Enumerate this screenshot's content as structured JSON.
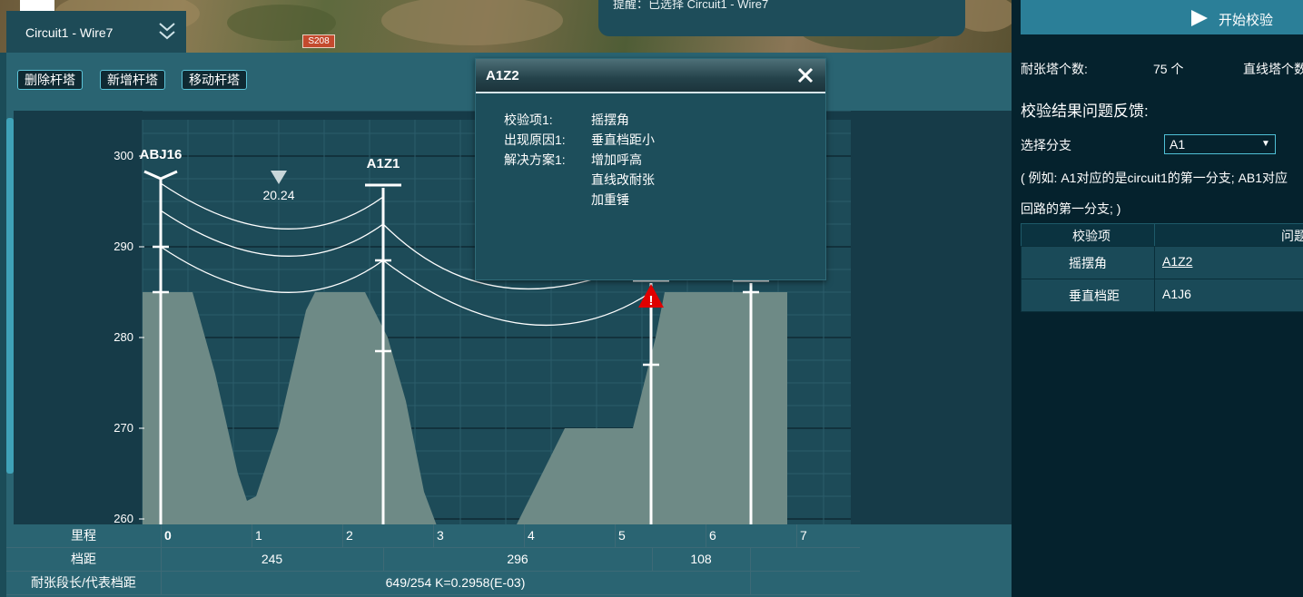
{
  "header": {
    "circuit_title": "Circuit1 - Wire7",
    "hint_text": "提醒：已选择 Circuit1 - Wire7",
    "road_badge": "S208"
  },
  "toolbar": {
    "delete_label": "删除杆塔",
    "add_label": "新增杆塔",
    "move_label": "移动杆塔"
  },
  "popup": {
    "title": "A1Z2",
    "rows": [
      {
        "key": "校验项1:",
        "value": "摇摆角"
      },
      {
        "key": "出现原因1:",
        "value": "垂直档距小"
      },
      {
        "key": "解决方案1:",
        "value": "增加呼高"
      },
      {
        "key": "",
        "value": "直线改耐张"
      },
      {
        "key": "",
        "value": "加重锤"
      }
    ]
  },
  "right_panel": {
    "start_label": "开始校验",
    "tension_count_label": "耐张塔个数:",
    "tension_count_value": "75 个",
    "straight_count_label": "直线塔个数",
    "feedback_title": "校验结果问题反馈:",
    "branch_label": "选择分支",
    "branch_value": "A1",
    "example_line1": "( 例如: A1对应的是circuit1的第一分支; AB1对应",
    "example_line2": "回路的第一分支; )",
    "table_headers": [
      "校验项",
      "问题"
    ],
    "table_rows": [
      {
        "item": "摇摆角",
        "issue": "A1Z2"
      },
      {
        "item": "垂直档距",
        "issue": "A1J6"
      }
    ]
  },
  "bottom_table": {
    "mileage_label": "里程",
    "span_label": "档距",
    "section_label": "耐张段长/代表档距",
    "mileage_ticks": [
      "0",
      "1",
      "2",
      "3",
      "4",
      "5",
      "6",
      "7"
    ],
    "spans": [
      "245",
      "296",
      "108"
    ],
    "section_value": "649/254 K=0.2958(E-03)"
  },
  "chart_data": {
    "type": "line",
    "title": "",
    "ylabel": "",
    "xlabel": "里程",
    "y_ticks": [
      "300",
      "290",
      "280",
      "270",
      "260"
    ],
    "ylim": [
      259,
      306
    ],
    "xlim": [
      0,
      7.6
    ],
    "grid": true,
    "towers": [
      {
        "name": "ABJ16",
        "x": 0.0,
        "top": 297.5,
        "marks": [
          290,
          285
        ]
      },
      {
        "name": "A1Z1",
        "x": 2.45,
        "top": 296.5,
        "marks": [
          288.5,
          278.5
        ]
      },
      {
        "name": "",
        "x": 5.4,
        "top": 286,
        "marks": [
          277
        ]
      },
      {
        "name": "",
        "x": 6.5,
        "top": 286,
        "marks": [
          285
        ]
      }
    ],
    "sag_marker": {
      "x": 1.3,
      "value": "20.24"
    },
    "warning_marker": {
      "x": 5.4,
      "y": 284.5,
      "label": "!"
    },
    "ground_profile": {
      "x": [
        -0.2,
        0.0,
        0.35,
        0.6,
        0.85,
        0.95,
        1.05,
        1.3,
        1.6,
        1.7,
        2.25,
        2.5,
        2.7,
        2.9,
        3.05,
        3.9,
        4.1,
        4.45,
        4.8,
        5.2,
        5.45,
        5.55,
        6.9
      ],
      "y": [
        285,
        285,
        285,
        276,
        265,
        262,
        262.5,
        270,
        283,
        285,
        285,
        280,
        273,
        263,
        259,
        259,
        263,
        270,
        270,
        270,
        280,
        285,
        285
      ]
    },
    "series": [
      {
        "x": [
          0.0,
          1.3,
          2.45
        ],
        "y": [
          297,
          292,
          295.5
        ]
      },
      {
        "x": [
          0.0,
          1.3,
          2.45,
          3.8,
          5.4
        ],
        "y": [
          294,
          289,
          292.5,
          285.5,
          289
        ]
      },
      {
        "x": [
          0.0,
          1.3,
          2.45,
          4.0,
          5.4
        ],
        "y": [
          290,
          285,
          288.5,
          281.5,
          285
        ]
      }
    ],
    "colors": {
      "ground": "#6e8a86",
      "wire": "#ffffff",
      "warning": "#e00000",
      "marker": "#c9d7da"
    }
  }
}
